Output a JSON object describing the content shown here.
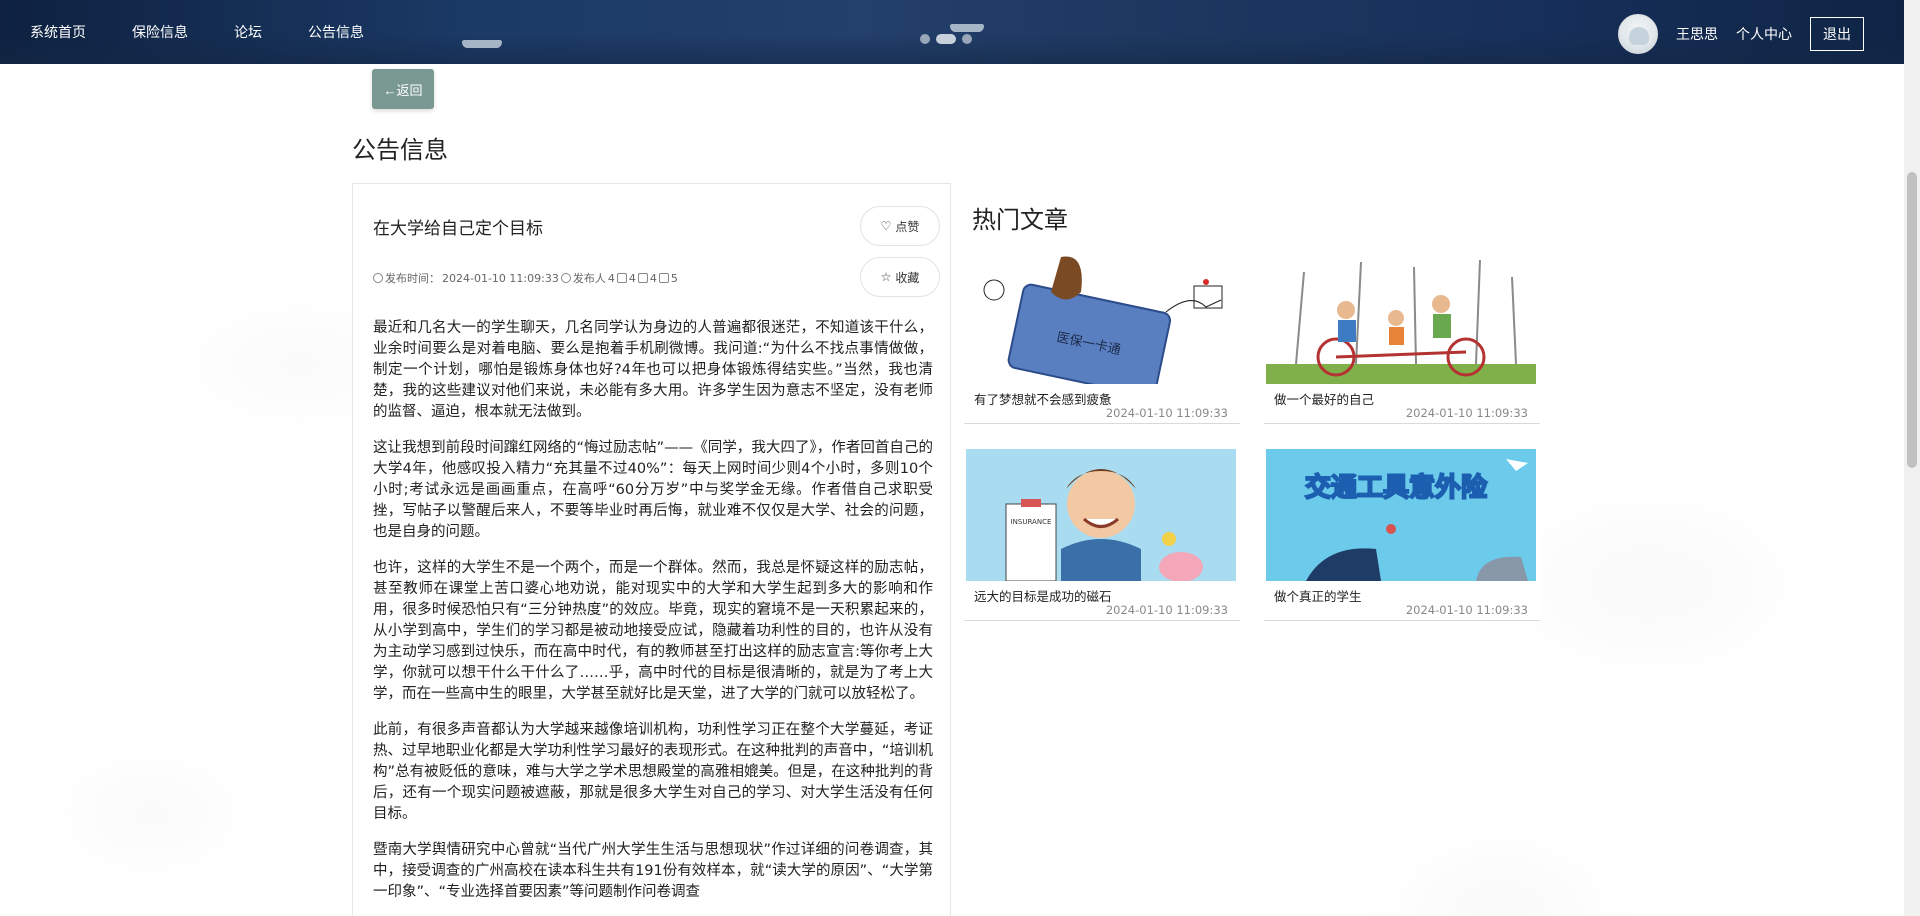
{
  "nav": {
    "items": [
      "系统首页",
      "保险信息",
      "论坛",
      "公告信息"
    ],
    "username": "王思思",
    "center": "个人中心",
    "logout": "退出"
  },
  "back_label": "←返回",
  "page_title": "公告信息",
  "article": {
    "title": "在大学给自己定个目标",
    "publish_label": "发布时间：",
    "publish_time": "2024-01-10 11:09:33",
    "publisher_label": "发布人",
    "publisher_count": "4",
    "likes": "4",
    "favorites": "4",
    "comments": "5",
    "like_label": "点赞",
    "fav_label": "收藏",
    "paragraphs": [
      "最近和几名大一的学生聊天，几名同学认为身边的人普遍都很迷茫，不知道该干什么，业余时间要么是对着电脑、要么是抱着手机刷微博。我问道:“为什么不找点事情做做，制定一个计划，哪怕是锻炼身体也好?4年也可以把身体锻炼得结实些。”当然，我也清楚，我的这些建议对他们来说，未必能有多大用。许多学生因为意志不坚定，没有老师的监督、逼迫，根本就无法做到。",
      "这让我想到前段时间蹿红网络的“悔过励志帖”——《同学，我大四了》，作者回首自己的大学4年，他感叹投入精力“充其量不过40%”：每天上网时间少则4个小时，多则10个小时;考试永远是画画重点，在高呼“60分万岁”中与奖学金无缘。作者借自己求职受挫，写帖子以警醒后来人，不要等毕业时再后悔，就业难不仅仅是大学、社会的问题，也是自身的问题。",
      "也许，这样的大学生不是一个两个，而是一个群体。然而，我总是怀疑这样的励志帖，甚至教师在课堂上苦口婆心地劝说，能对现实中的大学和大学生起到多大的影响和作用，很多时候恐怕只有“三分钟热度”的效应。毕竟，现实的窘境不是一天积累起来的，从小学到高中，学生们的学习都是被动地接受应试，隐藏着功利性的目的，也许从没有为主动学习感到过快乐，而在高中时代，有的教师甚至打出这样的励志宣言:等你考上大学，你就可以想干什么干什么了……乎，高中时代的目标是很清晰的，就是为了考上大学，而在一些高中生的眼里，大学甚至就好比是天堂，进了大学的门就可以放轻松了。",
      "此前，有很多声音都认为大学越来越像培训机构，功利性学习正在整个大学蔓延，考证热、过早地职业化都是大学功利性学习最好的表现形式。在这种批判的声音中，“培训机构”总有被贬低的意味，难与大学之学术思想殿堂的高雅相媲美。但是，在这种批判的背后，还有一个现实问题被遮蔽，那就是很多大学生对自己的学习、对大学生活没有任何目标。",
      "暨南大学舆情研究中心曾就“当代广州大学生生活与思想现状”作过详细的问卷调查，其中，接受调查的广州高校在读本科生共有191份有效样本，就“读大学的原因”、“大学第一印象”、“专业选择首要因素”等问题制作问卷调查"
    ]
  },
  "hot": {
    "title": "热门文章",
    "items": [
      {
        "name": "有了梦想就不会感到疲惫",
        "date": "2024-01-10 11:09:33",
        "image_text": "医保一卡通"
      },
      {
        "name": "做一个最好的自己",
        "date": "2024-01-10 11:09:33",
        "image_text": ""
      },
      {
        "name": "远大的目标是成功的磁石",
        "date": "2024-01-10 11:09:33",
        "image_text": "INSURANCE"
      },
      {
        "name": "做个真正的学生",
        "date": "2024-01-10 11:09:33",
        "image_text": "交通工具意外险"
      }
    ]
  },
  "colors": {
    "back_button": "#7b9993",
    "nav_bg": "#1b3a66"
  }
}
